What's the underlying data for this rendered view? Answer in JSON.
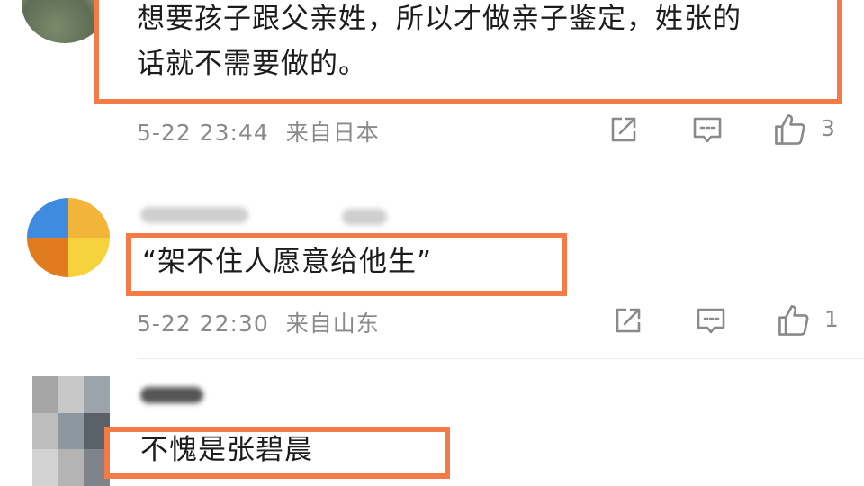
{
  "comments": [
    {
      "text": "想要孩子跟父亲姓，所以才做亲子鉴定，姓张的话就不需要做的。",
      "line1": "想要孩子跟父亲姓，所以才做亲子鉴定，姓张的",
      "line2": "话就不需要做的。",
      "time": "5-22 23:44",
      "location": "来自日本",
      "likes": "3"
    },
    {
      "text": "“架不住人愿意给他生”",
      "time": "5-22 22:30",
      "location": "来自山东",
      "likes": "1"
    },
    {
      "text": "不愧是张碧晨"
    }
  ],
  "colors": {
    "highlight_border": "#f47b45",
    "meta_text": "#8a8a8a",
    "body_text": "#1c1c1c"
  },
  "icons": [
    "share-icon",
    "comment-icon",
    "like-icon"
  ]
}
